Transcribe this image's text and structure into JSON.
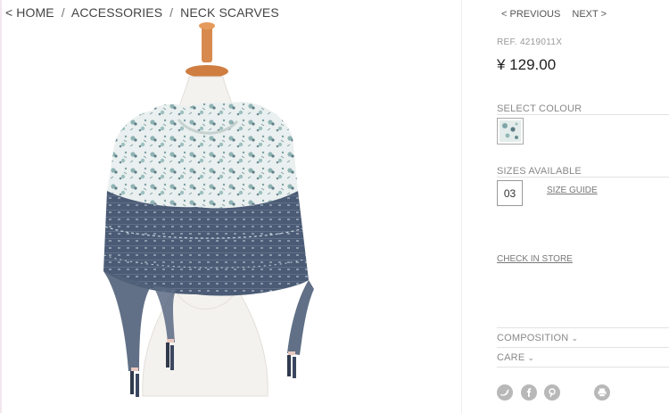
{
  "breadcrumb": {
    "back_arrow": "<",
    "home": "HOME",
    "separator": "/",
    "accessories": "ACCESSORIES",
    "current": "NECK SCARVES"
  },
  "pager": {
    "previous": "< PREVIOUS",
    "next": "NEXT >"
  },
  "product": {
    "ref": "REF. 4219011X",
    "price": "¥ 129.00"
  },
  "colour": {
    "label": "SELECT COLOUR",
    "selected_swatch": "floral-blue-swatch"
  },
  "sizes": {
    "label": "SIZES AVAILABLE",
    "options": [
      "03"
    ],
    "size_guide": "SIZE GUIDE"
  },
  "store": {
    "check_in_store": "CHECK IN STORE"
  },
  "accordion": {
    "composition": "COMPOSITION",
    "care": "CARE",
    "chevron": "⌄"
  },
  "social": {
    "icons": [
      "twitter-icon",
      "facebook-icon",
      "pinterest-icon",
      "print-icon"
    ]
  },
  "colors": {
    "scarf_navy": "#4a5a74",
    "scarf_floral_bg": "#e9efee",
    "mannequin": "#f4f2ef",
    "neck_wood": "#d88a4e"
  }
}
